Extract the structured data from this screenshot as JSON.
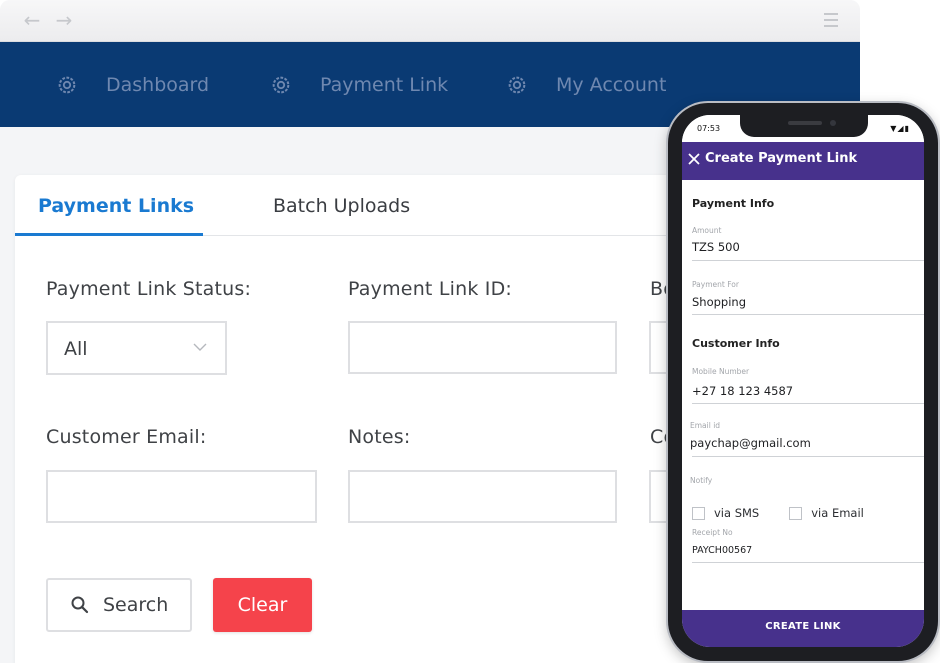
{
  "browser": {
    "nav": [
      {
        "label": "Dashboard",
        "icon": "gear-icon"
      },
      {
        "label": "Payment Link",
        "icon": "gear-icon"
      },
      {
        "label": "My Account",
        "icon": "gear-icon"
      }
    ]
  },
  "tabs": [
    {
      "label": "Payment Links",
      "active": true
    },
    {
      "label": "Batch Uploads",
      "active": false
    }
  ],
  "filters": {
    "status_label": "Payment Link Status:",
    "status_value": "All",
    "link_id_label": "Payment Link ID:",
    "third_col_label_partial": "Bo",
    "email_label": "Customer Email:",
    "notes_label": "Notes:",
    "sixth_col_label_partial": "Co",
    "link_id_value": "",
    "email_value": "",
    "notes_value": ""
  },
  "actions": {
    "search_label": "Search",
    "clear_label": "Clear"
  },
  "phone": {
    "status_time": "07:53",
    "app_title": "Create Payment Link",
    "payment_info_title": "Payment Info",
    "amount_label": "Amount",
    "amount_value": "TZS 500",
    "payment_for_label": "Payment For",
    "payment_for_value": "Shopping",
    "customer_info_title": "Customer Info",
    "mobile_label": "Mobile Number",
    "mobile_value": "+27 18 123 4587",
    "email_label": "Email id",
    "email_value": "paychap@gmail.com",
    "notify_label": "Notify",
    "notify_sms": "via SMS",
    "notify_email": "via Email",
    "receipt_label": "Receipt No",
    "receipt_value": "PAYCH00567",
    "create_button": "CREATE LINK"
  },
  "colors": {
    "nav_bg": "#0a3a73",
    "tab_active": "#1a7ad1",
    "clear_button": "#f5434b",
    "phone_accent": "#47318c"
  }
}
